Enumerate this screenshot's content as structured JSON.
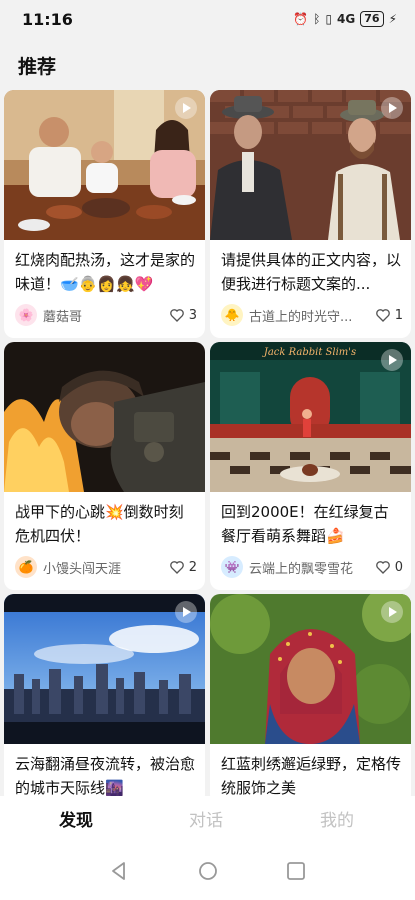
{
  "status": {
    "time": "11:16",
    "signal_text": "4G",
    "battery": "76"
  },
  "section_title": "推荐",
  "cards": [
    {
      "title": "红烧肉配热汤，这才是家的味道！🥣👵👩👧💖",
      "author": "蘑菇哥",
      "avatar": "🌸",
      "likes": "3",
      "image": "family-dinner"
    },
    {
      "title": "请提供具体的正文内容，以便我进行标题文案的...",
      "author": "古道上的时光守...",
      "avatar": "🐥",
      "likes": "1",
      "image": "two-men-brick-wall"
    },
    {
      "title": "战甲下的心跳💥倒数时刻危机四伏！",
      "author": "小馒头闯天涯",
      "avatar": "🍊",
      "likes": "2",
      "image": "soldier-fire"
    },
    {
      "title": "回到2000E！在红绿复古餐厅看萌系舞蹈🍰",
      "author": "云端上的飘零雪花",
      "avatar": "👾",
      "likes": "0",
      "image": "retro-diner",
      "image_sign": "Jack Rabbit Slim's"
    },
    {
      "title": "云海翻涌昼夜流转，被治愈的城市天际线🌆",
      "author": "",
      "avatar": "",
      "likes": "",
      "image": "city-skyline"
    },
    {
      "title": "红蓝刺绣邂逅绿野，定格传统服饰之美",
      "author": "",
      "avatar": "",
      "likes": "",
      "image": "woman-headscarf"
    }
  ],
  "nav": {
    "discover": "发现",
    "chat": "对话",
    "mine": "我的"
  },
  "colors": {
    "accent": "#111111",
    "inactive": "#c2c2c2",
    "background": "#f2f2f2"
  }
}
